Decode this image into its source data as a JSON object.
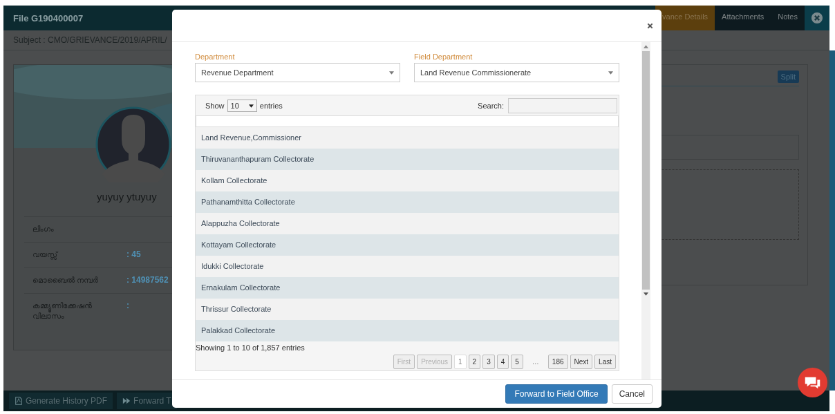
{
  "background": {
    "file_title": "File G190400007",
    "subject": "Subject : CMO/GRIEVANCE/2019/APRIL/",
    "tabs": [
      {
        "label": "vance Details",
        "selected": true
      },
      {
        "label": "Attachments",
        "selected": false
      },
      {
        "label": "Notes",
        "selected": false
      }
    ],
    "profile": {
      "name": "yuyuy ytuyuy",
      "fields": [
        {
          "label": "ലിംഗം"
        },
        {
          "label": "വയസ്സ്",
          "value": ": 45"
        },
        {
          "label": "മൊബൈൽ നമ്പർ",
          "value": ": 14987562"
        },
        {
          "label": "കമ്മ്യൂണിക്കേഷൻ വിലാസം",
          "value": ":"
        }
      ]
    },
    "split_button": "Split",
    "footer_buttons": [
      "Generate History PDF",
      "Forward T"
    ]
  },
  "dialog": {
    "department": {
      "label": "Department",
      "value": "Revenue Department"
    },
    "field_department": {
      "label": "Field Department",
      "value": "Land Revenue Commissionerate"
    },
    "table": {
      "show_label": "Show",
      "page_size": "10",
      "entries_label": "entries",
      "search_label": "Search:",
      "rows": [
        "Land Revenue,Commissioner",
        "Thiruvananthapuram Collectorate",
        "Kollam Collectorate",
        "Pathanamthitta Collectorate",
        "Alappuzha Collectorate",
        "Kottayam Collectorate",
        "Idukki Collectorate",
        "Ernakulam Collectorate",
        "Thrissur Collectorate",
        "Palakkad Collectorate"
      ],
      "info": "Showing 1 to 10 of 1,857 entries",
      "pagination": [
        {
          "label": "First",
          "disabled": true,
          "selected": false
        },
        {
          "label": "Previous",
          "disabled": true,
          "selected": false
        },
        {
          "label": "1",
          "disabled": false,
          "selected": true
        },
        {
          "label": "2",
          "disabled": false,
          "selected": false
        },
        {
          "label": "3",
          "disabled": false,
          "selected": false
        },
        {
          "label": "4",
          "disabled": false,
          "selected": false
        },
        {
          "label": "5",
          "disabled": false,
          "selected": false
        },
        {
          "label": "…",
          "kind": "ellipsis"
        },
        {
          "label": "186",
          "disabled": false,
          "selected": false
        },
        {
          "label": "Next",
          "disabled": false,
          "selected": false
        },
        {
          "label": "Last",
          "disabled": false,
          "selected": false
        }
      ]
    },
    "primary_button": "Forward to Field Office",
    "cancel_button": "Cancel"
  }
}
